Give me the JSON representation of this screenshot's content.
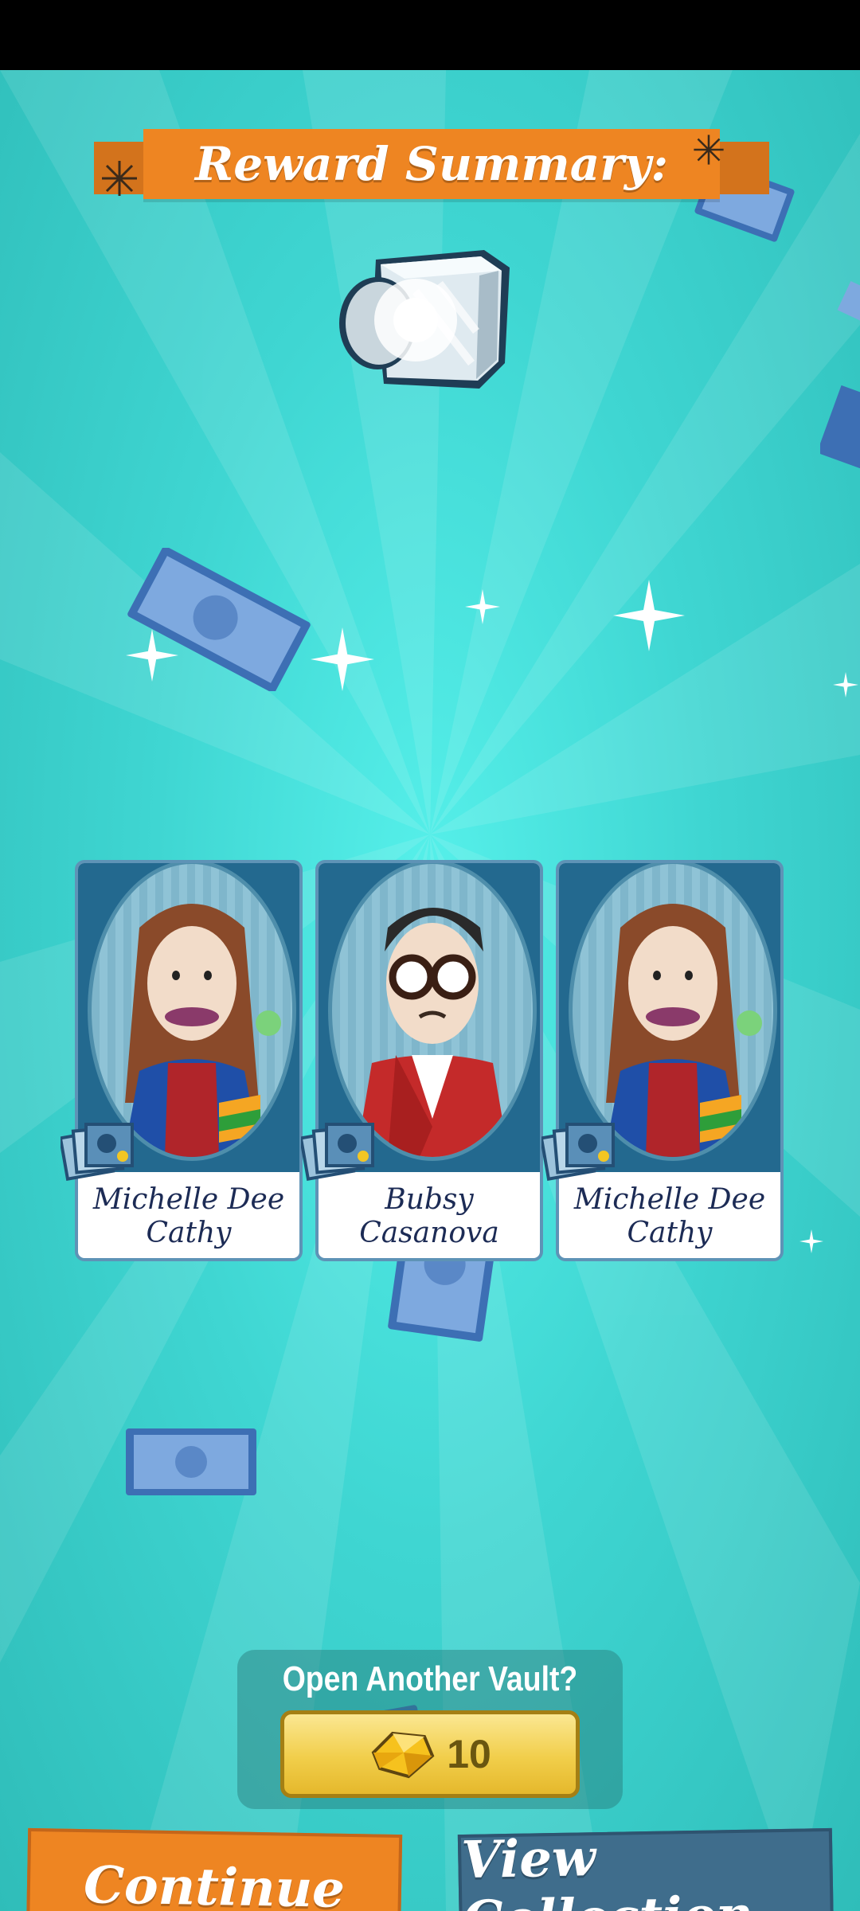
{
  "banner": {
    "title": "Reward Summary:"
  },
  "cards": [
    {
      "name_line1": "Michelle Dee",
      "name_line2": "Cathy"
    },
    {
      "name_line1": "Bubsy",
      "name_line2": "Casanova"
    },
    {
      "name_line1": "Michelle Dee",
      "name_line2": "Cathy"
    }
  ],
  "offer": {
    "label": "Open Another Vault?",
    "cost": "10",
    "cost_icon": "gem-icon"
  },
  "buttons": {
    "continue": "Continue",
    "view_collection": "View Collection"
  },
  "colors": {
    "orange": "#ee8522",
    "teal_bg": "#3fd6d2",
    "blue_button": "#3f6d8c",
    "gold_button": "#f1ce4a"
  }
}
